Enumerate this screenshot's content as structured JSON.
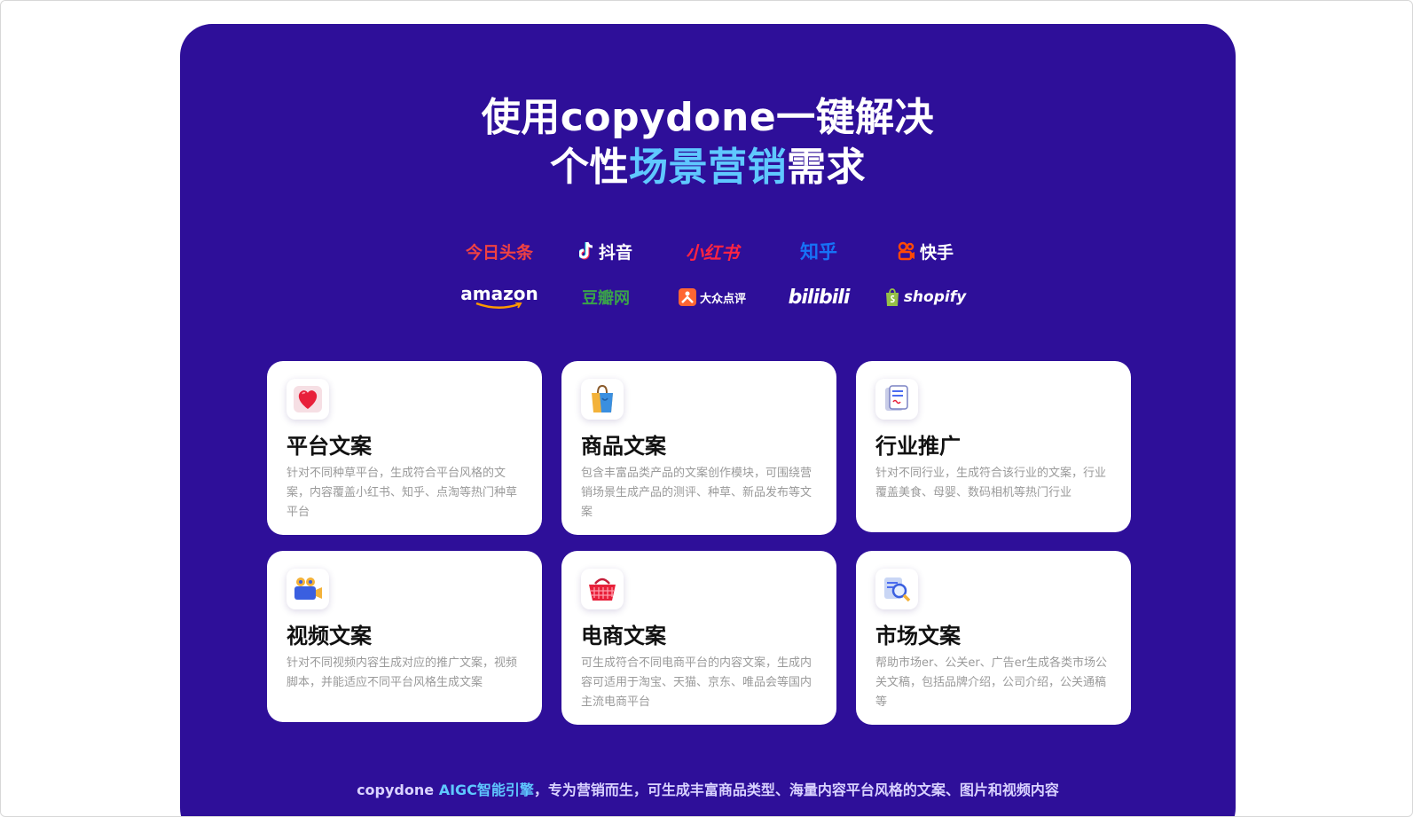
{
  "headline": {
    "line1": "使用copydone一键解决",
    "line2_prefix": "个性",
    "line2_accent": "场景营销",
    "line2_suffix": "需求"
  },
  "platforms": [
    {
      "name": "今日头条",
      "icon": "toutiao-logo"
    },
    {
      "name": "抖音",
      "icon": "douyin-logo"
    },
    {
      "name": "小红书",
      "icon": "xiaohongshu-logo"
    },
    {
      "name": "知乎",
      "icon": "zhihu-logo"
    },
    {
      "name": "快手",
      "icon": "kuaishou-logo"
    },
    {
      "name": "amazon",
      "icon": "amazon-logo"
    },
    {
      "name": "豆瓣网",
      "icon": "douban-logo"
    },
    {
      "name": "大众点评",
      "icon": "dianping-logo"
    },
    {
      "name": "bilibili",
      "icon": "bilibili-logo"
    },
    {
      "name": "shopify",
      "icon": "shopify-logo"
    }
  ],
  "cards": [
    {
      "title": "平台文案",
      "icon": "heart-icon",
      "desc": "针对不同种草平台，生成符合平台风格的文案，内容覆盖小红书、知乎、点淘等热门种草平台"
    },
    {
      "title": "商品文案",
      "icon": "shopping-bag-icon",
      "desc": "包含丰富品类产品的文案创作模块，可围绕营销场景生成产品的测评、种草、新品发布等文案"
    },
    {
      "title": "行业推广",
      "icon": "document-icon",
      "desc": "针对不同行业，生成符合该行业的文案，行业覆盖美食、母婴、数码相机等热门行业"
    },
    {
      "title": "视频文案",
      "icon": "video-camera-icon",
      "desc": "针对不同视频内容生成对应的推广文案，视频脚本，并能适应不同平台风格生成文案"
    },
    {
      "title": "电商文案",
      "icon": "shopping-basket-icon",
      "desc": "可生成符合不同电商平台的内容文案，生成内容可适用于淘宝、天猫、京东、唯品会等国内主流电商平台"
    },
    {
      "title": "市场文案",
      "icon": "search-document-icon",
      "desc": "帮助市场er、公关er、广告er生成各类市场公关文稿，包括品牌介绍，公司介绍，公关通稿等"
    }
  ],
  "footer": {
    "prefix": "copydone ",
    "accent": "AIGC智能引擎",
    "suffix": "，专为营销而生，可生成丰富商品类型、海量内容平台风格的文案、图片和视频内容"
  },
  "colors": {
    "panel": "#2e0f99",
    "accent": "#5fc8ff"
  }
}
